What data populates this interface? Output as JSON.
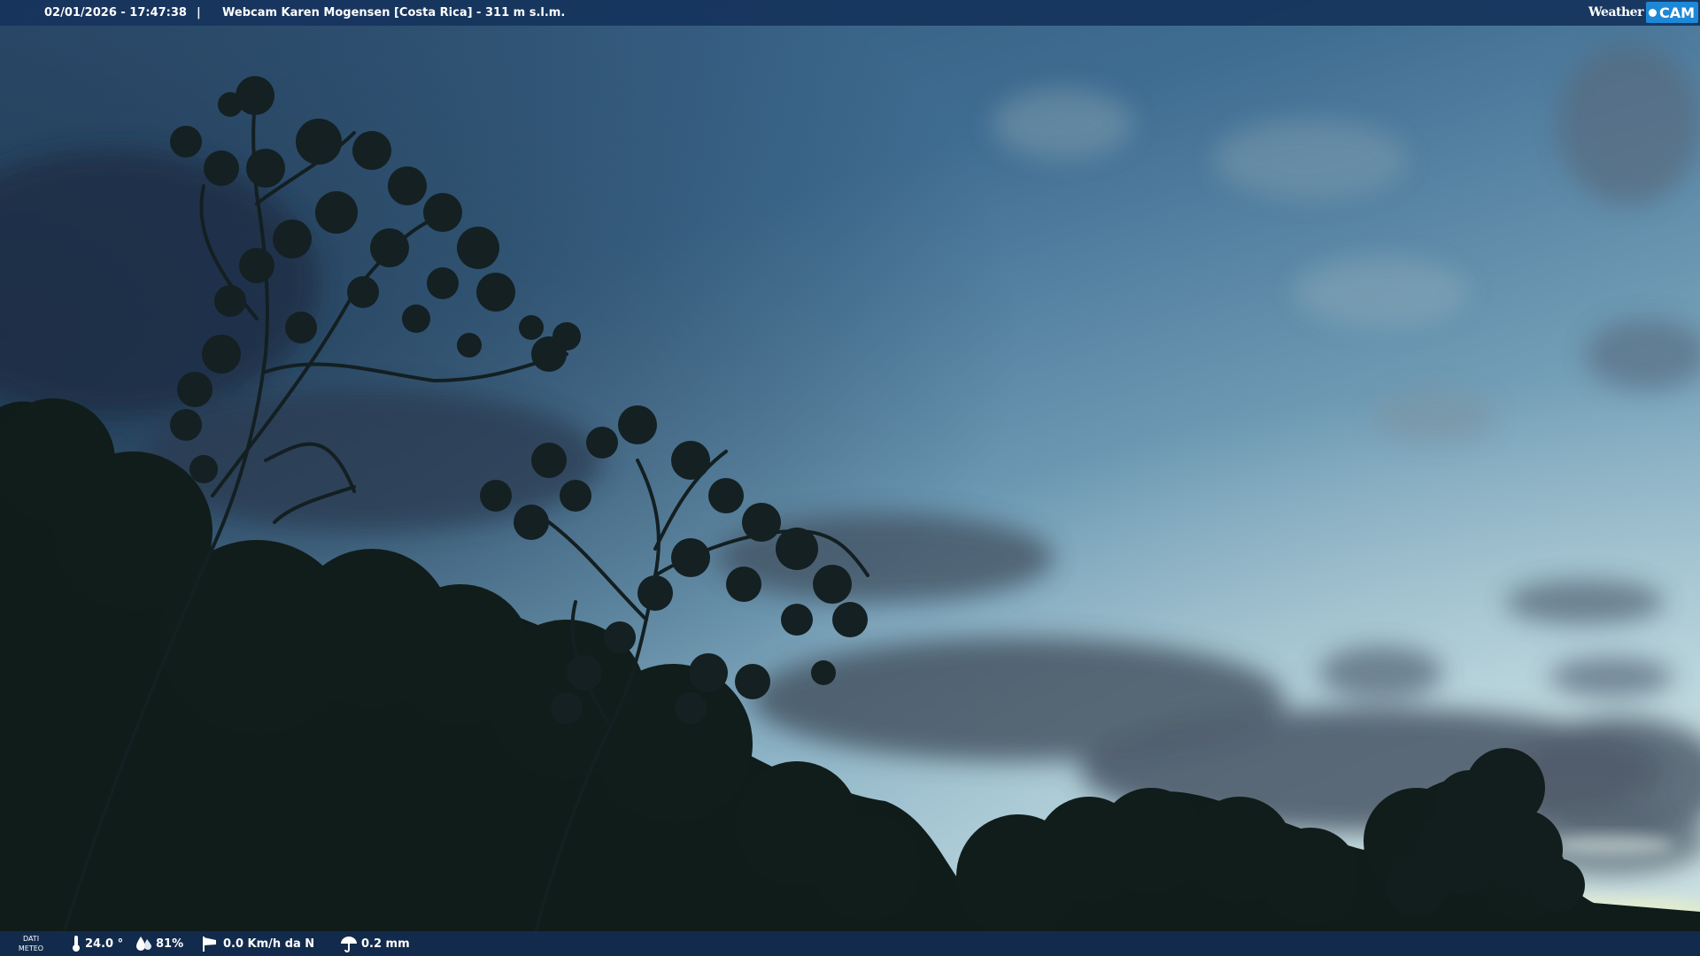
{
  "header": {
    "datetime": "02/01/2026 - 17:47:38",
    "separator": "|",
    "title": "Webcam Karen Mogensen [Costa Rica] - 311 m s.l.m."
  },
  "logo": {
    "weather_text": "Weather",
    "cam_text": "CAM",
    "accent_color": "#1e88d6"
  },
  "weather_data": {
    "panel_label_line1": "DATI",
    "panel_label_line2": "METEO",
    "temperature": "24.0 °",
    "temperature_icon": "thermometer-icon",
    "humidity": "81%",
    "humidity_icon": "drops-icon",
    "wind": "0.0 Km/h da N",
    "wind_icon": "windsock-icon",
    "rain": "0.2 mm",
    "rain_icon": "umbrella-icon"
  },
  "colors": {
    "bar_background": "#16345c",
    "sky_top": "#33597e",
    "sky_horizon": "#a6c7d3"
  }
}
